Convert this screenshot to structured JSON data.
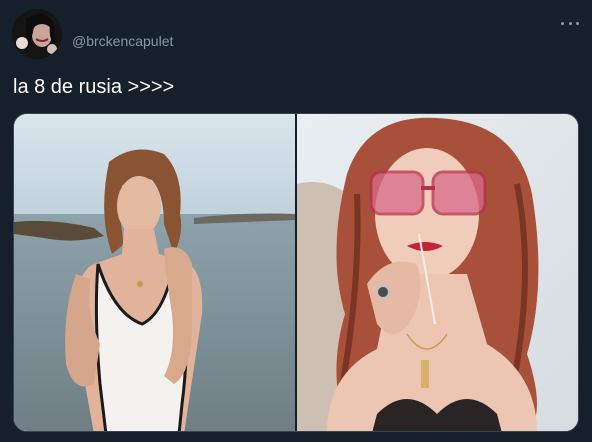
{
  "user": {
    "handle": "@brckencapulet",
    "avatar_icon": "profile-photo"
  },
  "tweet": {
    "text": "la 8 de rusia >>>>"
  },
  "media": {
    "images": [
      {
        "name": "photo-woman-white-swimsuit-sea"
      },
      {
        "name": "photo-woman-red-sunglasses"
      }
    ]
  },
  "icons": {
    "more": "more-options-icon"
  },
  "colors": {
    "background": "#15202b",
    "secondary_text": "#8899a6",
    "border": "#38444d"
  }
}
